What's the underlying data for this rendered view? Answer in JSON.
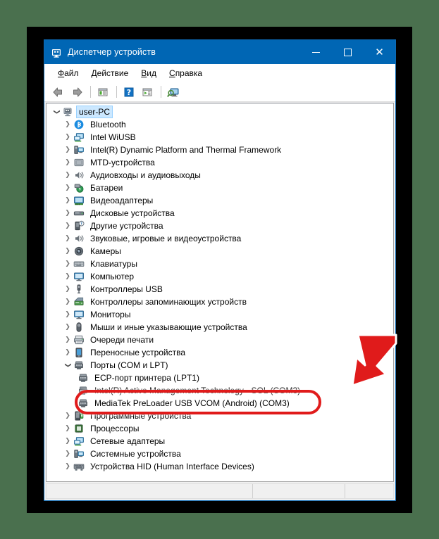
{
  "window": {
    "title": "Диспетчер устройств",
    "title_icon": "device-manager-icon",
    "minimize_label": "Свернуть",
    "maximize_label": "Развернуть",
    "close_label": "Закрыть"
  },
  "menu": [
    {
      "label": "Файл",
      "accel": "Ф",
      "rest": "айл",
      "name": "menu-file"
    },
    {
      "label": "Действие",
      "accel": "Д",
      "rest": "ействие",
      "name": "menu-action"
    },
    {
      "label": "Вид",
      "accel": "В",
      "rest": "ид",
      "name": "menu-view"
    },
    {
      "label": "Справка",
      "accel": "С",
      "rest": "правка",
      "name": "menu-help"
    }
  ],
  "toolbar": [
    {
      "icon": "back-arrow-icon",
      "name": "toolbar-back"
    },
    {
      "icon": "forward-arrow-icon",
      "name": "toolbar-forward"
    },
    {
      "icon": "separator",
      "name": "toolbar-separator-1"
    },
    {
      "icon": "properties-icon",
      "name": "toolbar-properties"
    },
    {
      "icon": "separator",
      "name": "toolbar-separator-2"
    },
    {
      "icon": "help-icon",
      "name": "toolbar-help"
    },
    {
      "icon": "update-driver-icon",
      "name": "toolbar-update-driver"
    },
    {
      "icon": "separator",
      "name": "toolbar-separator-3"
    },
    {
      "icon": "scan-hardware-icon",
      "name": "toolbar-scan-hardware"
    }
  ],
  "tree": [
    {
      "label": "user-PC",
      "level": 0,
      "state": "open",
      "icon": "computer-root-icon",
      "selected": true
    },
    {
      "label": "Bluetooth",
      "level": 1,
      "state": "closed",
      "icon": "bluetooth-icon"
    },
    {
      "label": "Intel WiUSB",
      "level": 1,
      "state": "closed",
      "icon": "network-icon"
    },
    {
      "label": "Intel(R) Dynamic Platform and Thermal Framework",
      "level": 1,
      "state": "closed",
      "icon": "system-device-icon"
    },
    {
      "label": "MTD-устройства",
      "level": 1,
      "state": "closed",
      "icon": "mtd-icon"
    },
    {
      "label": "Аудиовходы и аудиовыходы",
      "level": 1,
      "state": "closed",
      "icon": "speaker-icon"
    },
    {
      "label": "Батареи",
      "level": 1,
      "state": "closed",
      "icon": "battery-icon"
    },
    {
      "label": "Видеоадаптеры",
      "level": 1,
      "state": "closed",
      "icon": "display-adapter-icon"
    },
    {
      "label": "Дисковые устройства",
      "level": 1,
      "state": "closed",
      "icon": "disk-drive-icon"
    },
    {
      "label": "Другие устройства",
      "level": 1,
      "state": "closed",
      "icon": "unknown-device-icon"
    },
    {
      "label": "Звуковые, игровые и видеоустройства",
      "level": 1,
      "state": "closed",
      "icon": "speaker-icon"
    },
    {
      "label": "Камеры",
      "level": 1,
      "state": "closed",
      "icon": "camera-icon"
    },
    {
      "label": "Клавиатуры",
      "level": 1,
      "state": "closed",
      "icon": "keyboard-icon"
    },
    {
      "label": "Компьютер",
      "level": 1,
      "state": "closed",
      "icon": "monitor-icon"
    },
    {
      "label": "Контроллеры USB",
      "level": 1,
      "state": "closed",
      "icon": "usb-icon"
    },
    {
      "label": "Контроллеры запоминающих устройств",
      "level": 1,
      "state": "closed",
      "icon": "storage-controller-icon"
    },
    {
      "label": "Мониторы",
      "level": 1,
      "state": "closed",
      "icon": "monitor-icon"
    },
    {
      "label": "Мыши и иные указывающие устройства",
      "level": 1,
      "state": "closed",
      "icon": "mouse-icon"
    },
    {
      "label": "Очереди печати",
      "level": 1,
      "state": "closed",
      "icon": "printer-icon"
    },
    {
      "label": "Переносные устройства",
      "level": 1,
      "state": "closed",
      "icon": "portable-device-icon"
    },
    {
      "label": "Порты (COM и LPT)",
      "level": 1,
      "state": "open",
      "icon": "port-icon"
    },
    {
      "label": "ECP-порт принтера (LPT1)",
      "level": 2,
      "state": "leaf",
      "icon": "port-icon"
    },
    {
      "label": "Intel(R) Active Management Technology - SOL (COM3)",
      "level": 2,
      "state": "leaf",
      "icon": "port-icon",
      "occluded": true
    },
    {
      "label": "MediaTek PreLoader USB VCOM (Android) (COM3)",
      "level": 2,
      "state": "leaf",
      "icon": "port-icon",
      "highlighted": true
    },
    {
      "label": "Программные устройства",
      "level": 1,
      "state": "closed",
      "icon": "software-device-icon"
    },
    {
      "label": "Процессоры",
      "level": 1,
      "state": "closed",
      "icon": "processor-icon"
    },
    {
      "label": "Сетевые адаптеры",
      "level": 1,
      "state": "closed",
      "icon": "network-icon"
    },
    {
      "label": "Системные устройства",
      "level": 1,
      "state": "closed",
      "icon": "system-device-icon"
    },
    {
      "label": "Устройства HID (Human Interface Devices)",
      "level": 1,
      "state": "closed",
      "icon": "hid-icon"
    }
  ],
  "statusbar": {
    "pane1": "",
    "pane2": "",
    "pane3": ""
  },
  "annotations": {
    "highlight_color": "#e01b1b",
    "ellipse_target": "MediaTek PreLoader USB VCOM (Android) (COM3)",
    "arrow_name": "red-pointer-arrow"
  },
  "colors": {
    "titlebar": "#0066b4",
    "backdrop": "#4a704e",
    "frame": "#000000",
    "selection": "#cce8ff",
    "annotation": "#e01b1b"
  }
}
